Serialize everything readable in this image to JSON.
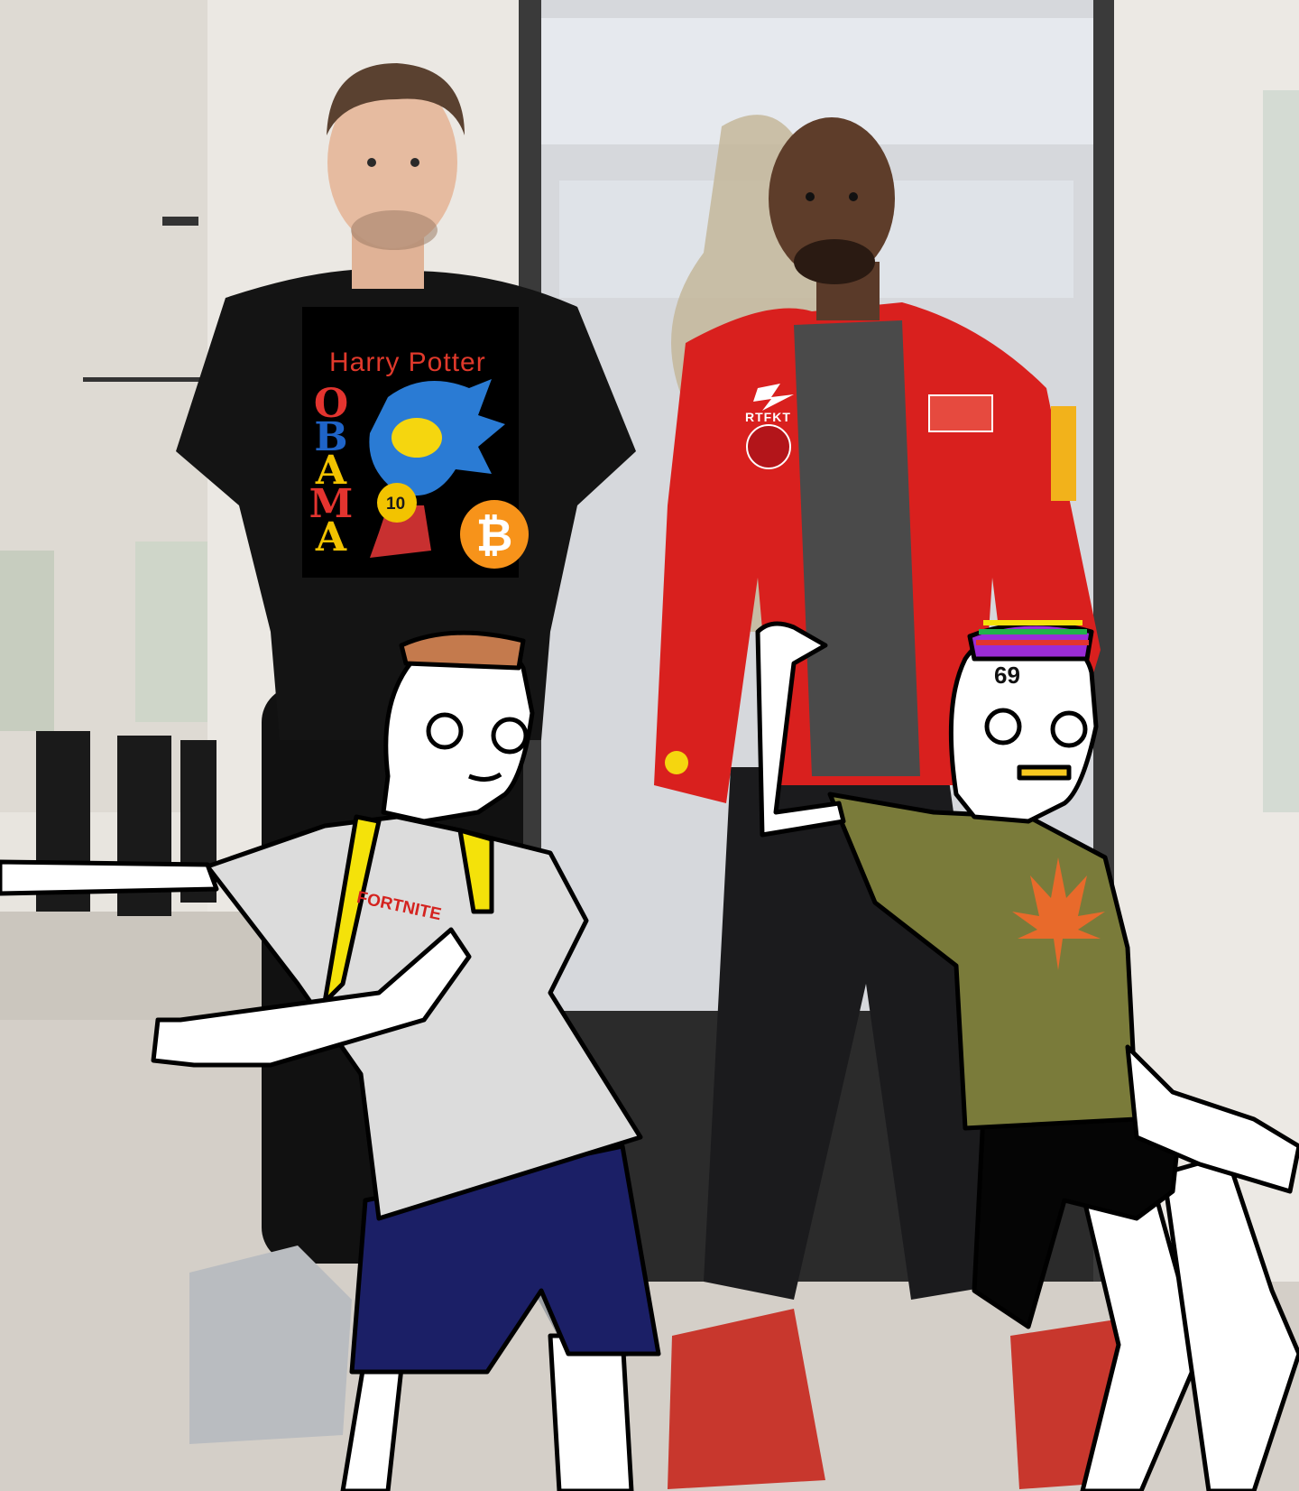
{
  "scene": {
    "left_shirt": {
      "title": "Harry Potter",
      "letters": [
        "O",
        "B",
        "A",
        "M",
        "A"
      ],
      "letter_colors": [
        "#e3342f",
        "#1f64c8",
        "#f2c300",
        "#e3342f",
        "#f2c300"
      ],
      "coin_number": "10"
    },
    "jacket": {
      "brand": "RTFKT"
    },
    "left_figure": {
      "shirt_text": "FORTNITE"
    },
    "right_figure": {
      "number": "69"
    }
  },
  "colors": {
    "wall": "#e9e6e0",
    "floor": "#cfcac3",
    "black_shirt": "#121212",
    "red_jacket": "#d9201e",
    "grey_shirt": "#dcdcdc",
    "olive_shirt": "#7a7b3a",
    "navy_shorts": "#1b1f66",
    "bitcoin": "#f7931a"
  }
}
